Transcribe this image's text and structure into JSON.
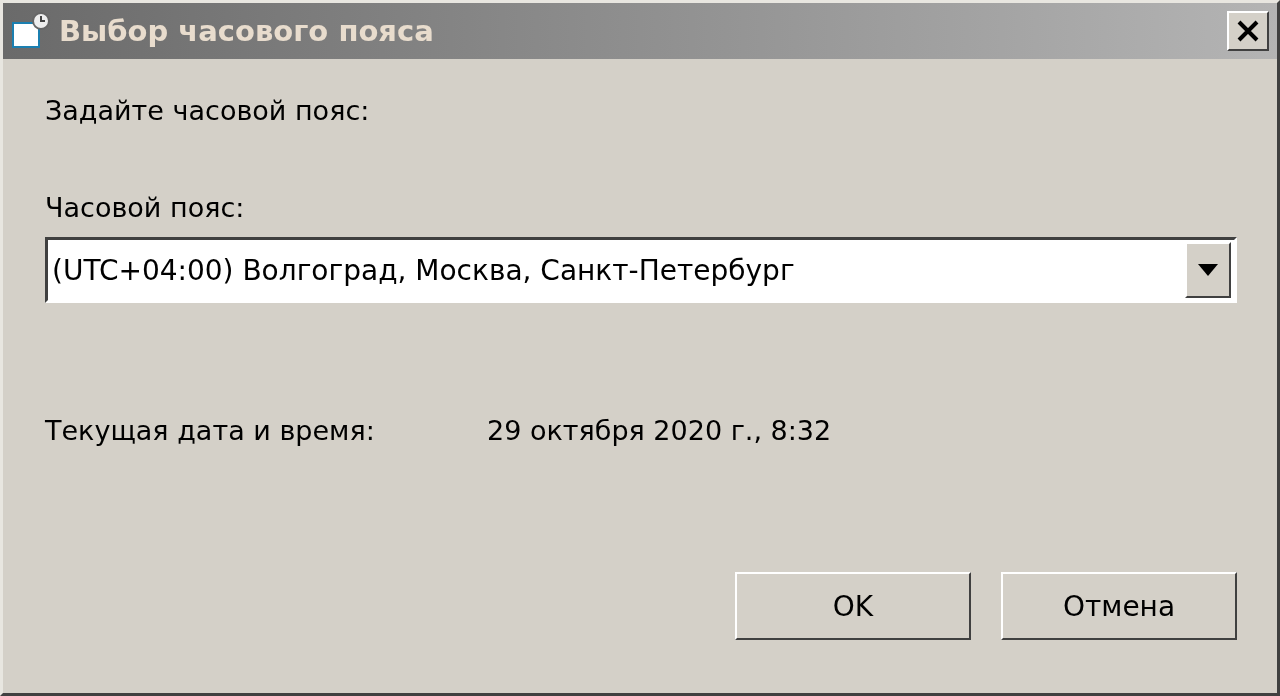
{
  "window": {
    "title": "Выбор часового пояса"
  },
  "prompt": "Задайте часовой пояс:",
  "timezone_field": {
    "label": "Часовой пояс:",
    "value": "(UTC+04:00) Волгоград, Москва, Санкт-Петербург"
  },
  "current_datetime": {
    "label": "Текущая дата и время:",
    "value": "29 октября 2020 г., 8:32"
  },
  "buttons": [
    "OK",
    "Отмена"
  ]
}
